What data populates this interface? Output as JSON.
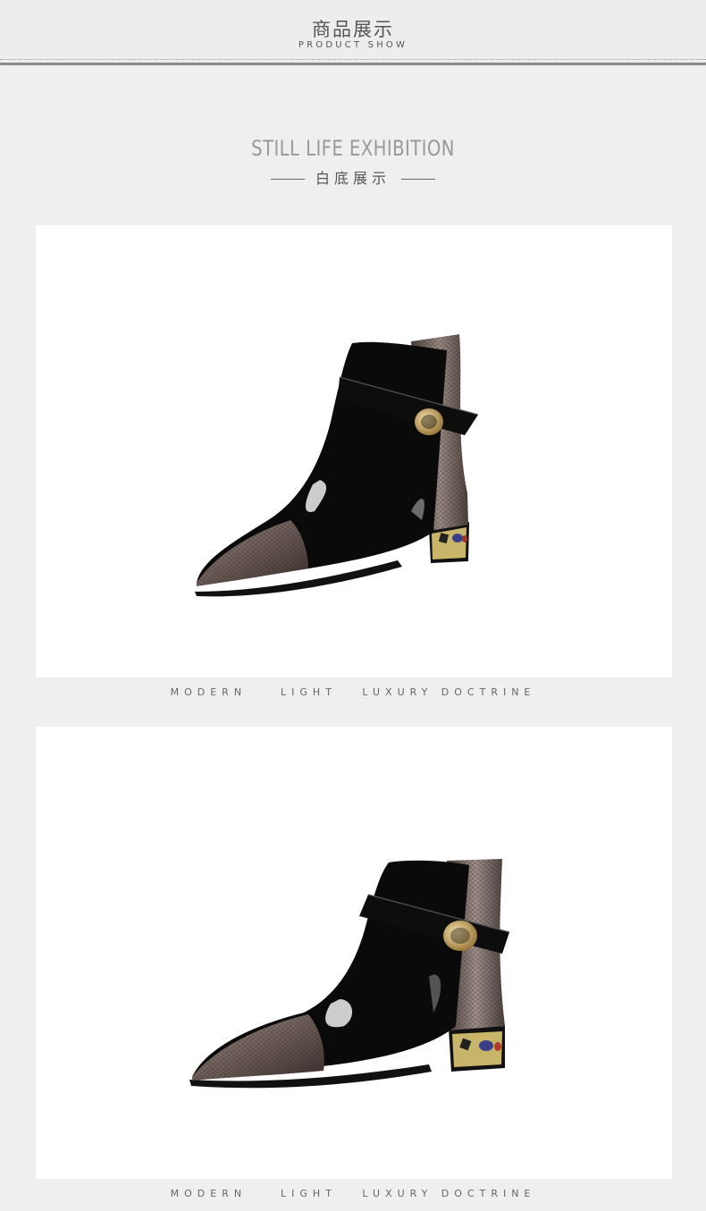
{
  "header": {
    "cn_title": "商品展示",
    "en_subtitle": "PRODUCT SHOW"
  },
  "section": {
    "title": "STILL LIFE  EXHIBITION",
    "subtitle": "白底展示"
  },
  "cards": [
    {
      "image": "black-patent-ankle-boot-side-view",
      "tagline": "MODERN    LIGHT   LUXURY DOCTRINE"
    },
    {
      "image": "black-patent-ankle-boot-angled-view",
      "tagline": "MODERN    LIGHT   LUXURY DOCTRINE"
    }
  ],
  "colors": {
    "page_bg": "#efefef",
    "card_bg": "#ffffff",
    "title_gray": "#9a9a9a",
    "text_dark": "#555555"
  }
}
